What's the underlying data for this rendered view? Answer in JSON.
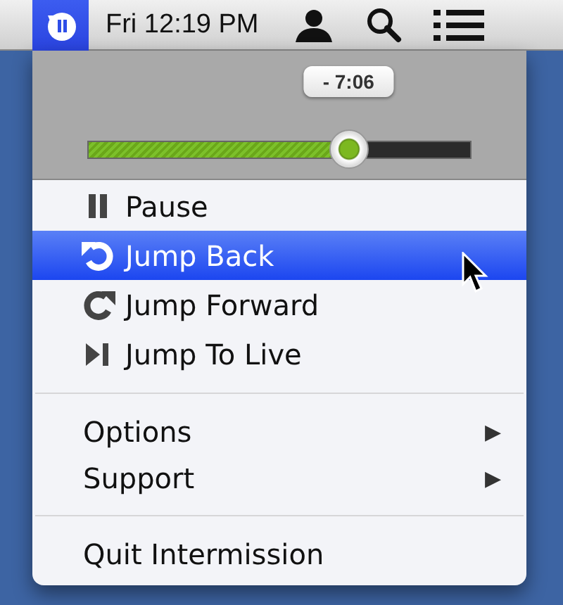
{
  "menu_bar": {
    "clock": "Fri 12:19 PM"
  },
  "scrubber": {
    "time_remaining": "- 7:06",
    "level": 0.68
  },
  "playback_items": [
    {
      "label": "Pause",
      "selected": false
    },
    {
      "label": "Jump Back",
      "selected": true
    },
    {
      "label": "Jump Forward",
      "selected": false
    },
    {
      "label": "Jump To Live",
      "selected": false
    }
  ],
  "submenus": [
    {
      "label": "Options",
      "arrow": "▶"
    },
    {
      "label": "Support",
      "arrow": "▶"
    }
  ],
  "quit_item": {
    "label": "Quit Intermission"
  }
}
